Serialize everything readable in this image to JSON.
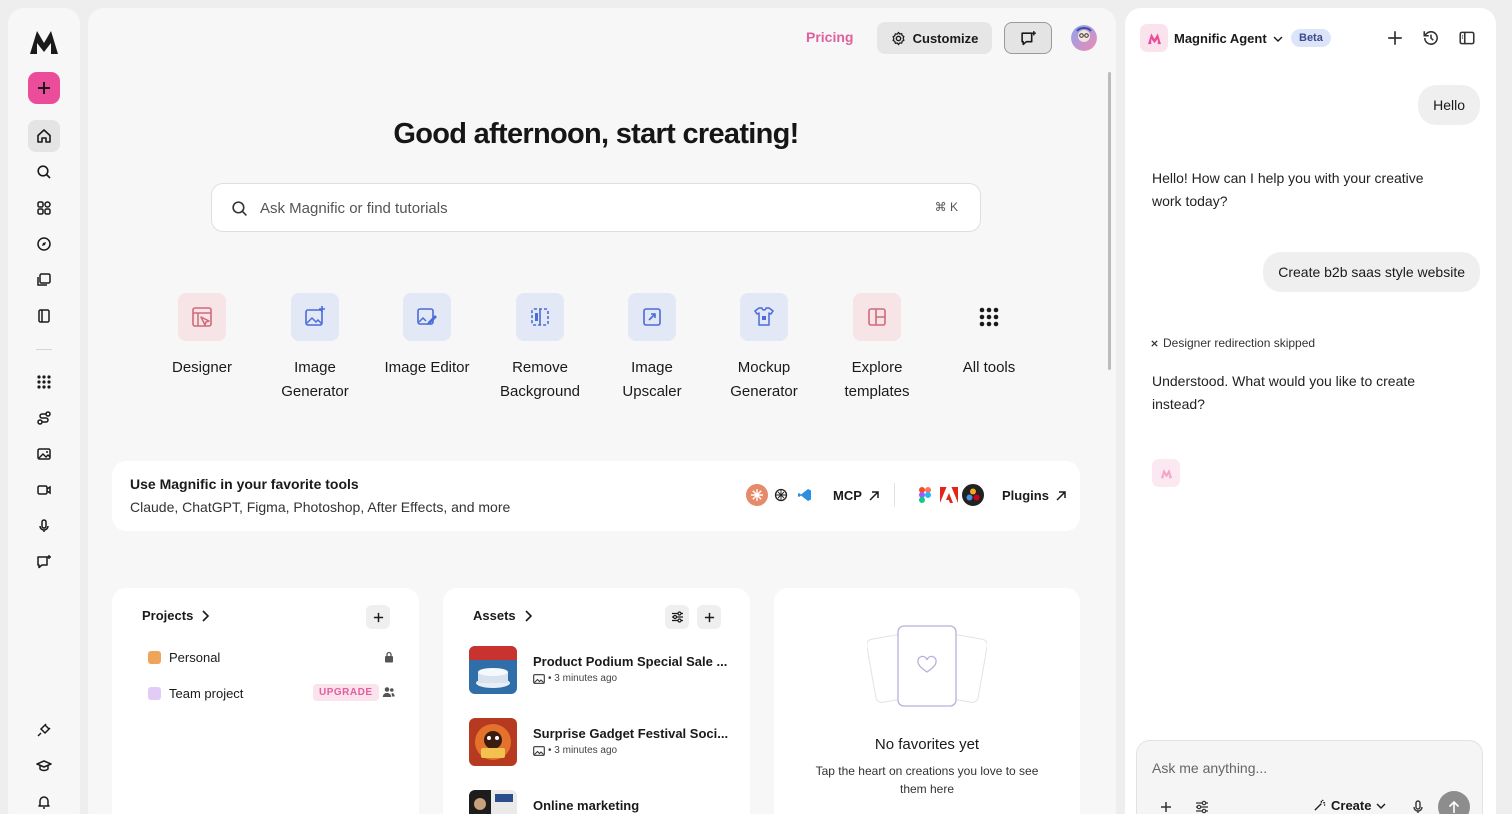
{
  "topbar": {
    "pricing": "Pricing",
    "customize": "Customize"
  },
  "greeting": "Good afternoon, start creating!",
  "search": {
    "placeholder": "Ask Magnific or find tutorials",
    "shortcut": "⌘ K"
  },
  "tools": [
    {
      "label": "Designer",
      "icon": "designer-icon",
      "color": "#d06a78",
      "bg": "#f6e4e6"
    },
    {
      "label": "Image Generator",
      "icon": "image-generator-icon",
      "color": "#4a6bd9",
      "bg": "#e3e8f7"
    },
    {
      "label": "Image Editor",
      "icon": "image-editor-icon",
      "color": "#4a6bd9",
      "bg": "#e3e8f7"
    },
    {
      "label": "Remove Background",
      "icon": "remove-background-icon",
      "color": "#4a6bd9",
      "bg": "#e3e8f7"
    },
    {
      "label": "Image Upscaler",
      "icon": "image-upscaler-icon",
      "color": "#4a6bd9",
      "bg": "#e3e8f7"
    },
    {
      "label": "Mockup Generator",
      "icon": "mockup-generator-icon",
      "color": "#4a6bd9",
      "bg": "#e3e8f7"
    },
    {
      "label": "Explore templates",
      "icon": "templates-icon",
      "color": "#d06a78",
      "bg": "#f6e4e6"
    },
    {
      "label": "All tools",
      "icon": "grid-icon",
      "color": "#1a1a1a",
      "bg": "transparent"
    }
  ],
  "fav_tools": {
    "title": "Use Magnific in your favorite tools",
    "subtitle": "Claude, ChatGPT, Figma, Photoshop, After Effects, and more",
    "mcp": "MCP",
    "plugins": "Plugins"
  },
  "projects": {
    "title": "Projects",
    "items": [
      {
        "name": "Personal",
        "color": "#f0a45a"
      },
      {
        "name": "Team project",
        "color": "#e2cbf7",
        "badge": "UPGRADE"
      }
    ]
  },
  "assets": {
    "title": "Assets",
    "items": [
      {
        "name": "Product Podium Special Sale ...",
        "meta": "• 3 minutes ago"
      },
      {
        "name": "Surprise Gadget Festival Soci...",
        "meta": "• 3 minutes ago"
      },
      {
        "name": "Online marketing"
      }
    ]
  },
  "favorites": {
    "title": "No favorites yet",
    "body": "Tap the heart on creations you love to see them here"
  },
  "agent": {
    "name": "Magnific Agent",
    "badge": "Beta",
    "messages": {
      "user1": "Hello",
      "bot1": "Hello! How can I help you with your creative work today?",
      "user2": "Create b2b saas style website",
      "status": "Designer redirection skipped",
      "bot2": "Understood. What would you like to create instead?"
    },
    "composer": {
      "placeholder": "Ask me anything...",
      "mode": "Create"
    }
  },
  "colors": {
    "accent": "#ec4d9a",
    "pricing": "#e0609e",
    "beta_bg": "#dce4fa"
  }
}
